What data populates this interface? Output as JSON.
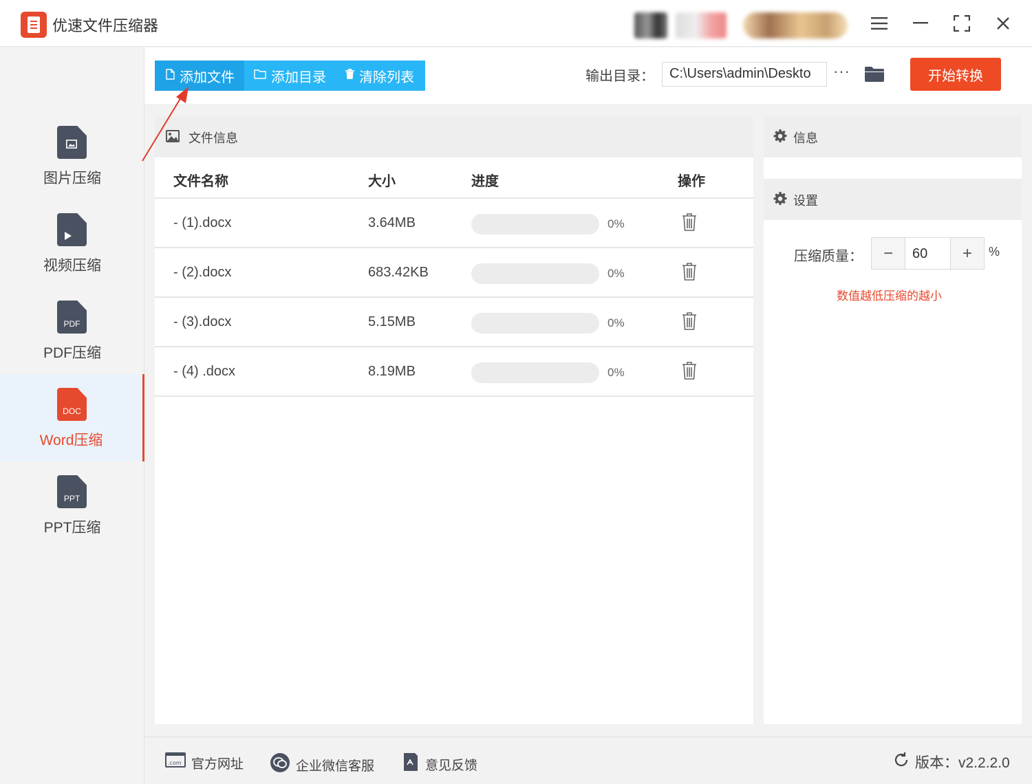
{
  "app": {
    "title": "优速文件压缩器"
  },
  "sidebar": {
    "items": [
      {
        "label": "图片压缩",
        "tag": ""
      },
      {
        "label": "视频压缩",
        "tag": ""
      },
      {
        "label": "PDF压缩",
        "tag": "PDF"
      },
      {
        "label": "Word压缩",
        "tag": "DOC"
      },
      {
        "label": "PPT压缩",
        "tag": "PPT"
      }
    ],
    "active_index": 3
  },
  "toolbar": {
    "add_file": "添加文件",
    "add_folder": "添加目录",
    "clear_list": "清除列表",
    "output_label": "输出目录：",
    "output_path": "C:\\Users\\admin\\Deskto",
    "more": "···",
    "start": "开始转换"
  },
  "file_panel": {
    "title": "文件信息",
    "columns": {
      "name": "文件名称",
      "size": "大小",
      "progress": "进度",
      "action": "操作"
    },
    "rows": [
      {
        "name": "- (1).docx",
        "size": "3.64MB",
        "progress_text": "0%",
        "progress": 0
      },
      {
        "name": "- (2).docx",
        "size": "683.42KB",
        "progress_text": "0%",
        "progress": 0
      },
      {
        "name": "- (3).docx",
        "size": "5.15MB",
        "progress_text": "0%",
        "progress": 0
      },
      {
        "name": "- (4) .docx",
        "size": "8.19MB",
        "progress_text": "0%",
        "progress": 0
      }
    ]
  },
  "info_panel": {
    "title": "信息"
  },
  "settings_panel": {
    "title": "设置",
    "quality_label": "压缩质量：",
    "quality_value": "60",
    "minus": "−",
    "plus": "+",
    "unit": "%",
    "hint": "数值越低压缩的越小"
  },
  "footer": {
    "website": "官方网址",
    "wechat": "企业微信客服",
    "feedback": "意见反馈",
    "version": "版本：v2.2.2.0"
  },
  "colors": {
    "accent": "#e64a2e",
    "primary": "#29b6f6",
    "start_button": "#ee4a24"
  }
}
